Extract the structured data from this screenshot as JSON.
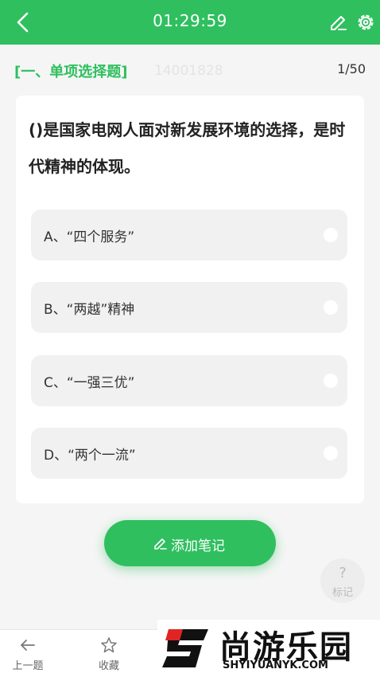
{
  "topbar": {
    "timer": "01:29:59",
    "back_icon": "chevron-left-icon",
    "edit_icon": "pen-icon",
    "settings_icon": "gear-icon"
  },
  "header": {
    "section": "[一、单项选择题]",
    "question_id": "14001828",
    "progress": "1/50"
  },
  "question": {
    "text": "()是国家电网人面对新发展环境的选择，是时代精神的体现。"
  },
  "options": [
    {
      "label": "A、“四个服务”"
    },
    {
      "label": "B、“两越”精神"
    },
    {
      "label": "C、“一强三优”"
    },
    {
      "label": "D、“两个一流”"
    }
  ],
  "note_button": {
    "label": "添加笔记"
  },
  "mark_button": {
    "symbol": "?",
    "label": "标记"
  },
  "bottom_nav": {
    "prev_label": "上一题",
    "favorite_label": "收藏"
  },
  "watermark": {
    "brand": "尚游乐园",
    "domain": "SHYIYUANYK.COM"
  },
  "colors": {
    "primary": "#2fbf5f",
    "background": "#f5f5f5",
    "option_bg": "#f1f1f1"
  }
}
